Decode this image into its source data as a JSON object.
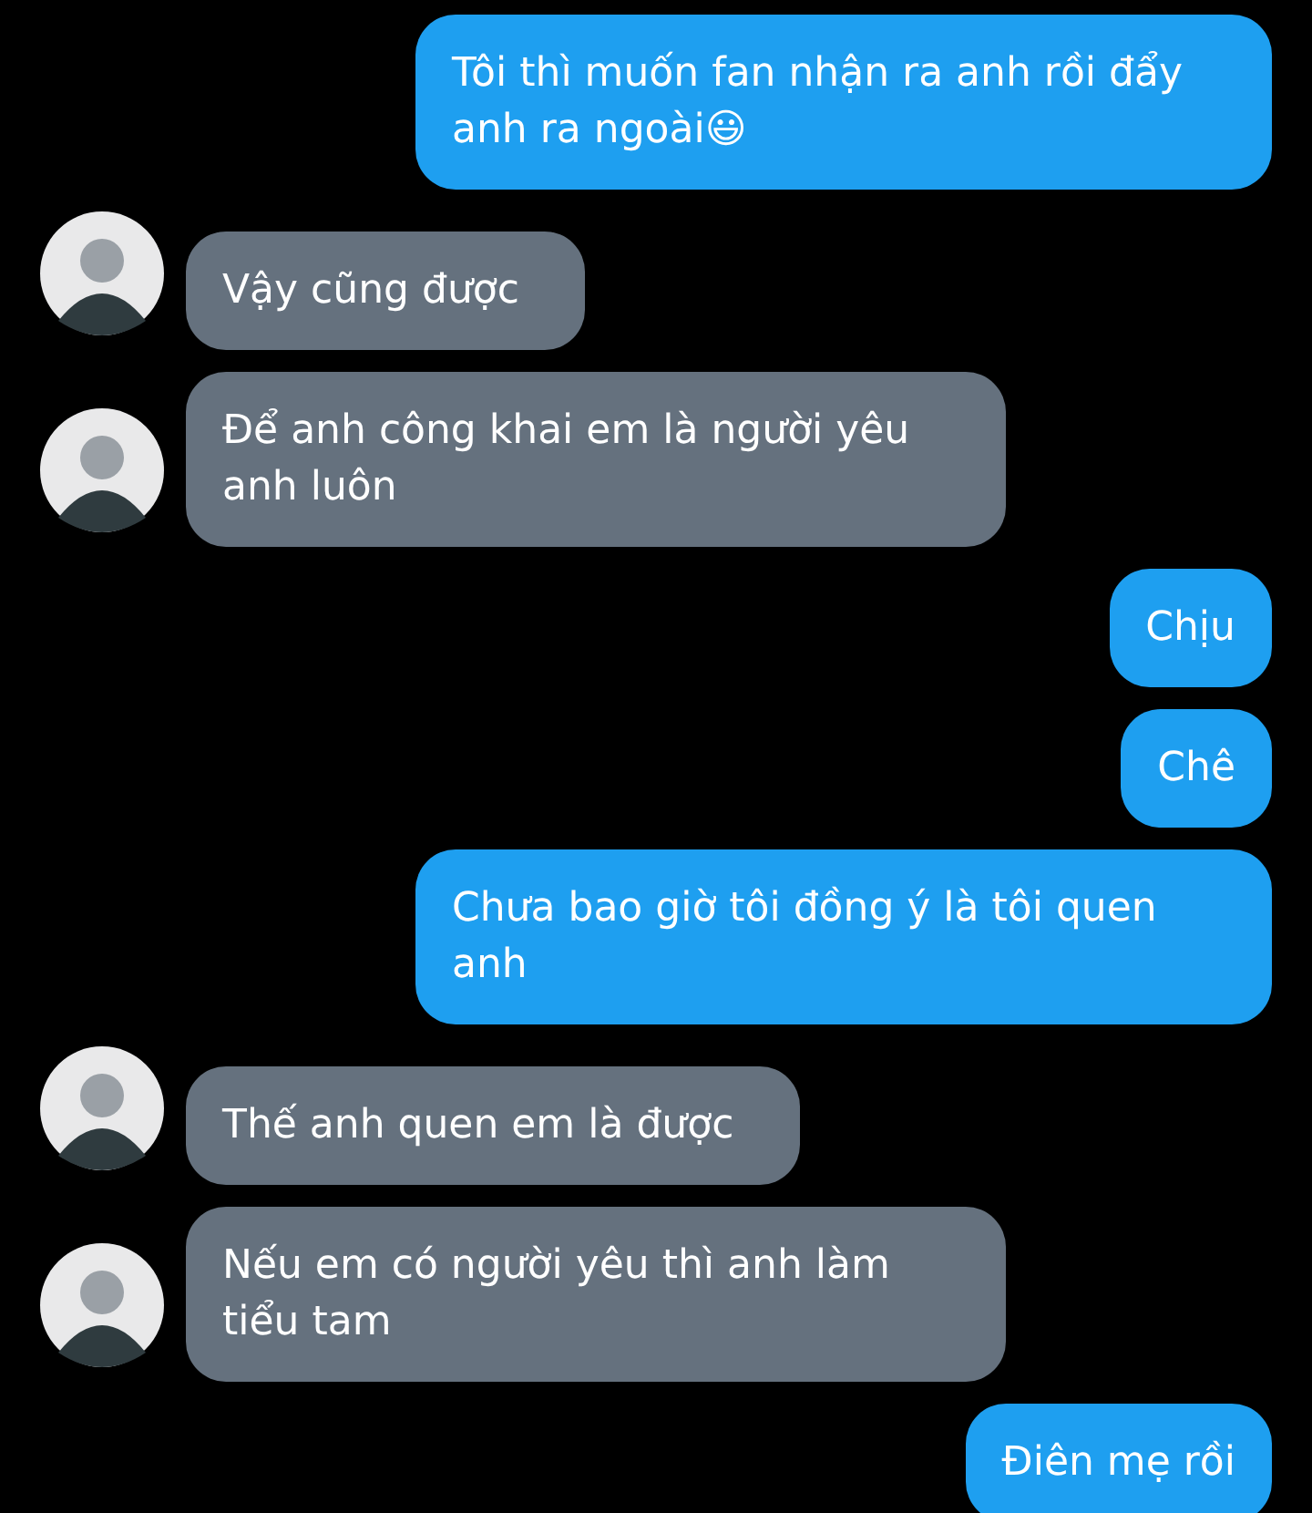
{
  "messages": [
    {
      "kind": "outgoing",
      "text": "Tôi thì muốn fan nhận ra anh rồi đẩy anh ra ngoài😃"
    },
    {
      "kind": "incoming",
      "text": "Vậy cũng được"
    },
    {
      "kind": "incoming",
      "text": "Để anh công khai em là người yêu anh luôn"
    },
    {
      "kind": "outgoing",
      "text": "Chịu"
    },
    {
      "kind": "outgoing",
      "text": "Chê"
    },
    {
      "kind": "outgoing",
      "text": "Chưa bao giờ tôi đồng ý là tôi quen anh"
    },
    {
      "kind": "incoming",
      "text": "Thế anh quen em là được"
    },
    {
      "kind": "incoming",
      "text": "Nếu em có người yêu thì anh làm tiểu tam"
    },
    {
      "kind": "outgoing",
      "text": "Điên mẹ rồi"
    }
  ]
}
